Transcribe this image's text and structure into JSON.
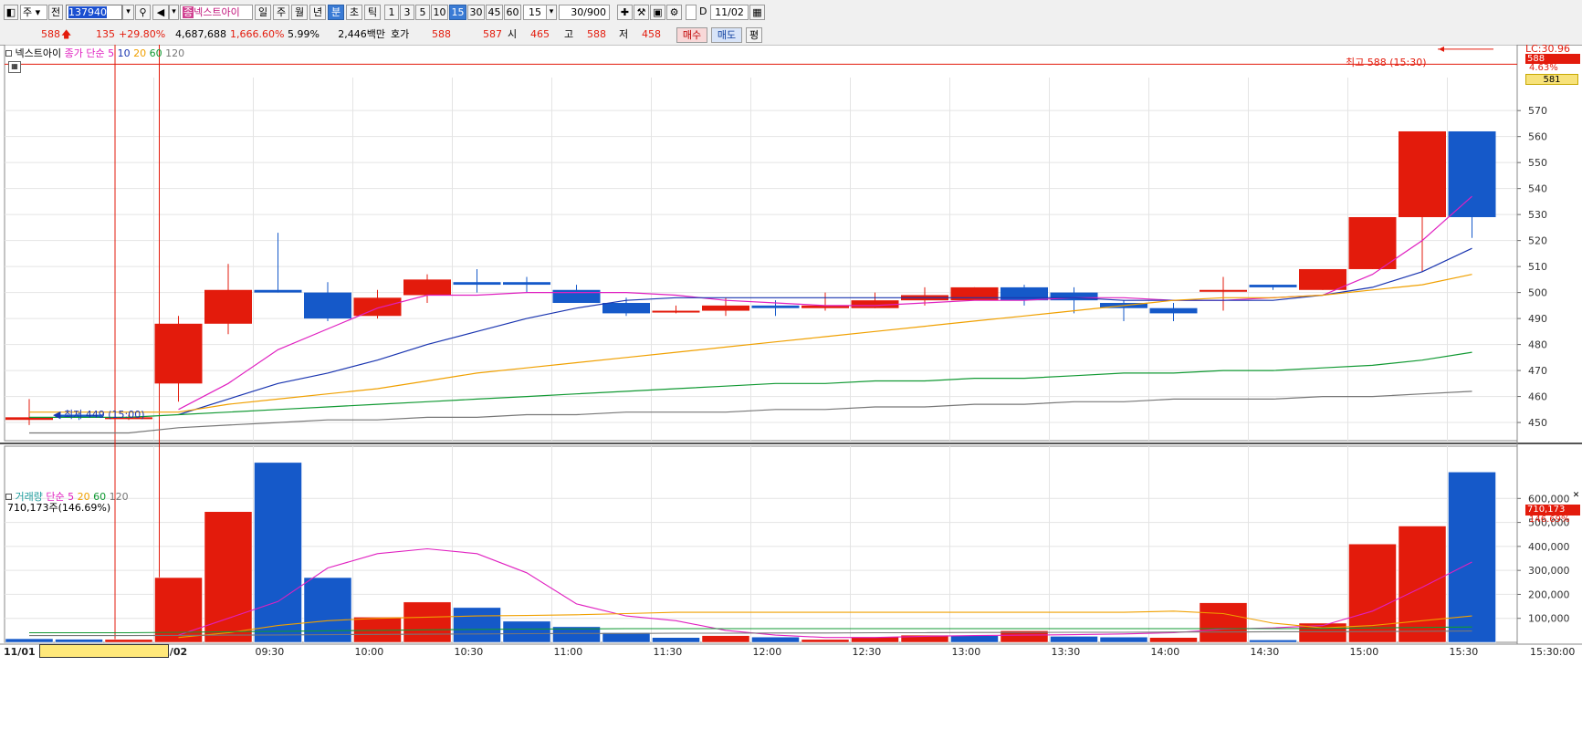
{
  "toolbar": {
    "market": "주",
    "market_mode": "전",
    "code": "137940",
    "stock_name": "넥스트아이",
    "periods": [
      "일",
      "주",
      "월",
      "년",
      "분",
      "초",
      "틱"
    ],
    "selected_period": "분",
    "intervals": [
      "1",
      "3",
      "5",
      "10",
      "15",
      "30",
      "45",
      "60"
    ],
    "selected_interval": "15",
    "interval_value": "15",
    "count": "30/900",
    "d_label": "D",
    "date": "11/02"
  },
  "quote": {
    "price": "588",
    "change": "135",
    "change_pct": "+29.80%",
    "volume": "4,687,688",
    "volume_pct": "1,666.60%",
    "turnover_pct": "5.99%",
    "amount": "2,446백만",
    "hoga_label": "호가",
    "ask": "588",
    "bid": "587",
    "open_label": "시",
    "open": "465",
    "high_label": "고",
    "high": "588",
    "low_label": "저",
    "low": "458",
    "buy_label": "매수",
    "sell_label": "매도",
    "eval_label": "평"
  },
  "price_panel": {
    "legend_name": "넥스트아이",
    "legend_ma": "종가 단순",
    "ma_periods": [
      "5",
      "10",
      "20",
      "60",
      "120"
    ],
    "ma_colors": [
      "#e020c0",
      "#1a35b0",
      "#f0a000",
      "#119933",
      "#777777"
    ],
    "lc_label": "LC:30.96",
    "last_price_tag": "588",
    "last_pct_tag": "4.63%",
    "ma_tag": "581",
    "high_annotation": "최고 588 (15:30)",
    "low_annotation": "최저 449 (15:00)",
    "y_ticks": [
      "570",
      "560",
      "550",
      "540",
      "530",
      "520",
      "510",
      "500",
      "490",
      "480",
      "470",
      "460",
      "450"
    ]
  },
  "volume_panel": {
    "legend_name": "거래량",
    "legend_ma": "단순",
    "ma_periods": [
      "5",
      "20",
      "60",
      "120"
    ],
    "ma_colors": [
      "#e020c0",
      "#f0a000",
      "#119933",
      "#777777"
    ],
    "current_volume": "710,173주(146.69%)",
    "volume_tag": "710,173",
    "volume_pct_tag": "146.69%",
    "y_ticks": [
      "600,000",
      "500,000",
      "400,000",
      "300,000",
      "200,000",
      "100,000"
    ]
  },
  "x_axis": {
    "labels": [
      "11/01",
      "11/02",
      "09:30",
      "10:00",
      "10:30",
      "11:00",
      "11:30",
      "12:00",
      "12:30",
      "13:00",
      "13:30",
      "14:00",
      "14:30",
      "15:00",
      "15:30",
      "15:30:00"
    ]
  },
  "chart_data": {
    "type": "candlestick",
    "title": "",
    "series": [
      {
        "name": "넥스트아이",
        "x": [
          "11/01 15:00",
          "11/01 15:15",
          "11/01 15:30",
          "11/02 09:00",
          "09:15",
          "09:30",
          "09:45",
          "10:00",
          "10:15",
          "10:30",
          "10:45",
          "11:00",
          "11:15",
          "11:30",
          "11:45",
          "12:00",
          "12:15",
          "12:30",
          "12:45",
          "13:00",
          "13:15",
          "13:30",
          "13:45",
          "14:00",
          "14:15",
          "14:30",
          "14:45",
          "15:00",
          "15:15",
          "15:30"
        ],
        "open": [
          451,
          453,
          452,
          465,
          488,
          501,
          500,
          491,
          499,
          504,
          504,
          501,
          496,
          493,
          493,
          495,
          494,
          494,
          497,
          497,
          502,
          500,
          496,
          494,
          501,
          503,
          501,
          509,
          529,
          562
        ],
        "high": [
          459,
          454,
          453,
          491,
          511,
          523,
          504,
          501,
          507,
          509,
          506,
          503,
          498,
          495,
          498,
          497,
          500,
          500,
          502,
          502,
          503,
          502,
          497,
          496,
          506,
          503,
          505,
          510,
          530,
          562
        ],
        "low": [
          449,
          451,
          451,
          458,
          484,
          500,
          489,
          490,
          496,
          500,
          500,
          496,
          491,
          492,
          491,
          491,
          493,
          494,
          495,
          497,
          495,
          492,
          489,
          489,
          493,
          501,
          501,
          509,
          508,
          521
        ],
        "close": [
          452,
          452,
          452,
          488,
          501,
          500,
          490,
          498,
          505,
          503,
          503,
          496,
          492,
          493,
          495,
          494,
          495,
          497,
          499,
          502,
          497,
          497,
          494,
          492,
          501,
          502,
          509,
          529,
          562,
          529
        ]
      },
      {
        "name": "5",
        "values": [
          null,
          null,
          null,
          455,
          465,
          478,
          486,
          494,
          499,
          499,
          500,
          500,
          500,
          499,
          497,
          496,
          495,
          495,
          496,
          497,
          497,
          498,
          498,
          497,
          497,
          498,
          499,
          507,
          520,
          537
        ]
      },
      {
        "name": "10",
        "values": [
          null,
          null,
          null,
          453,
          459,
          465,
          469,
          474,
          480,
          485,
          490,
          494,
          497,
          498,
          498,
          498,
          498,
          498,
          498,
          498,
          498,
          498,
          497,
          497,
          497,
          497,
          499,
          502,
          508,
          517
        ]
      },
      {
        "name": "20",
        "values": [
          454,
          454,
          454,
          454,
          457,
          459,
          461,
          463,
          466,
          469,
          471,
          473,
          475,
          477,
          479,
          481,
          483,
          485,
          487,
          489,
          491,
          493,
          495,
          497,
          498,
          498,
          499,
          501,
          503,
          507
        ]
      },
      {
        "name": "60",
        "values": [
          452,
          452,
          452,
          453,
          454,
          455,
          456,
          457,
          458,
          459,
          460,
          461,
          462,
          463,
          464,
          465,
          465,
          466,
          466,
          467,
          467,
          468,
          469,
          469,
          470,
          470,
          471,
          472,
          474,
          477
        ]
      },
      {
        "name": "120",
        "values": [
          446,
          446,
          446,
          448,
          449,
          450,
          451,
          451,
          452,
          452,
          453,
          453,
          454,
          454,
          454,
          455,
          455,
          456,
          456,
          457,
          457,
          458,
          458,
          459,
          459,
          459,
          460,
          460,
          461,
          462
        ]
      }
    ],
    "volume": {
      "values": [
        15000,
        13000,
        12000,
        270000,
        545000,
        750000,
        270000,
        105000,
        168000,
        145000,
        88000,
        65000,
        40000,
        20000,
        28000,
        22000,
        12000,
        22000,
        30000,
        28000,
        48000,
        25000,
        22000,
        20000,
        165000,
        10000,
        80000,
        410000,
        485000,
        710173
      ],
      "up": [
        false,
        false,
        true,
        true,
        true,
        false,
        false,
        true,
        true,
        false,
        false,
        false,
        false,
        false,
        true,
        false,
        true,
        true,
        true,
        false,
        true,
        false,
        false,
        true,
        true,
        false,
        true,
        true,
        true,
        false
      ],
      "ma5": [
        null,
        null,
        null,
        30000,
        100000,
        170000,
        310000,
        370000,
        390000,
        370000,
        290000,
        160000,
        110000,
        90000,
        50000,
        30000,
        20000,
        20000,
        25000,
        28000,
        30000,
        32000,
        35000,
        40000,
        55000,
        60000,
        70000,
        130000,
        230000,
        335000
      ],
      "ma20": [
        null,
        null,
        null,
        20000,
        40000,
        70000,
        90000,
        100000,
        105000,
        110000,
        112000,
        115000,
        120000,
        125000,
        125000,
        125000,
        125000,
        125000,
        125000,
        125000,
        125000,
        125000,
        125000,
        130000,
        120000,
        80000,
        60000,
        70000,
        90000,
        110000
      ],
      "ma60": [
        40000,
        40000,
        40000,
        42000,
        44000,
        46000,
        48000,
        50000,
        52000,
        54000,
        55000,
        56000,
        57000,
        57000,
        57000,
        57000,
        57000,
        57000,
        57000,
        57000,
        57000,
        57000,
        57000,
        57000,
        57000,
        57000,
        58000,
        60000,
        62000,
        64000
      ],
      "ma120": [
        28000,
        28000,
        28000,
        29000,
        30000,
        31000,
        32000,
        33000,
        34000,
        35000,
        36000,
        37000,
        37000,
        38000,
        38000,
        39000,
        39000,
        40000,
        40000,
        41000,
        41000,
        42000,
        42000,
        43000,
        43000,
        44000,
        44000,
        45000,
        46000,
        47000
      ]
    },
    "price_ylim": [
      443,
      582
    ],
    "volume_ylim": [
      0,
      780000
    ],
    "grid": true
  }
}
